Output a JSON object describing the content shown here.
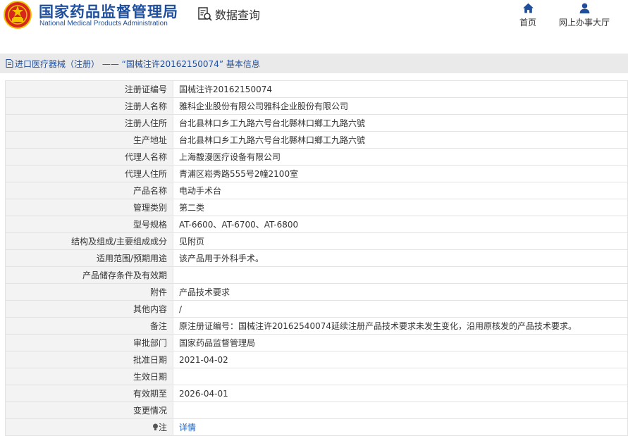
{
  "header": {
    "brand_cn": "国家药品监督管理局",
    "brand_en": "National Medical Products Administration",
    "query_label": "数据查询",
    "nav": {
      "home_label": "首页",
      "hall_label": "网上办事大厅"
    }
  },
  "breadcrumb": {
    "text": "进口医疗器械（注册） —— “国械注许20162150074” 基本信息"
  },
  "rows": [
    {
      "label": "注册证编号",
      "value": "国械注许20162150074"
    },
    {
      "label": "注册人名称",
      "value": "雅科企业股份有限公司雅科企业股份有限公司"
    },
    {
      "label": "注册人住所",
      "value": "台北县林口乡工九路六号台北縣林口鄉工九路六號"
    },
    {
      "label": "生产地址",
      "value": "台北县林口乡工九路六号台北縣林口鄉工九路六號"
    },
    {
      "label": "代理人名称",
      "value": "上海馥漫医疗设备有限公司"
    },
    {
      "label": "代理人住所",
      "value": "青浦区崧秀路555号2幢2100室"
    },
    {
      "label": "产品名称",
      "value": "电动手术台"
    },
    {
      "label": "管理类别",
      "value": "第二类"
    },
    {
      "label": "型号规格",
      "value": "AT-6600、AT-6700、AT-6800"
    },
    {
      "label": "结构及组成/主要组成成分",
      "value": "见附页"
    },
    {
      "label": "适用范围/预期用途",
      "value": "该产品用于外科手术。"
    },
    {
      "label": "产品储存条件及有效期",
      "value": ""
    },
    {
      "label": "附件",
      "value": "产品技术要求"
    },
    {
      "label": "其他内容",
      "value": "/"
    },
    {
      "label": "备注",
      "value": "原注册证编号：国械注许20162540074延续注册产品技术要求未发生变化，沿用原核发的产品技术要求。"
    },
    {
      "label": "审批部门",
      "value": "国家药品监督管理局"
    },
    {
      "label": "批准日期",
      "value": "2021-04-02"
    },
    {
      "label": "生效日期",
      "value": ""
    },
    {
      "label": "有效期至",
      "value": "2026-04-01"
    },
    {
      "label": "变更情况",
      "value": ""
    }
  ],
  "note_row": {
    "label": "注",
    "link": "详情"
  },
  "colors": {
    "brand_blue": "#1f4e9c",
    "link_blue": "#1a66cc",
    "label_bg": "#f3f3f3",
    "crumb_bg": "#eaeaea",
    "emblem_red": "#d7261e",
    "emblem_gold": "#f2c200"
  }
}
